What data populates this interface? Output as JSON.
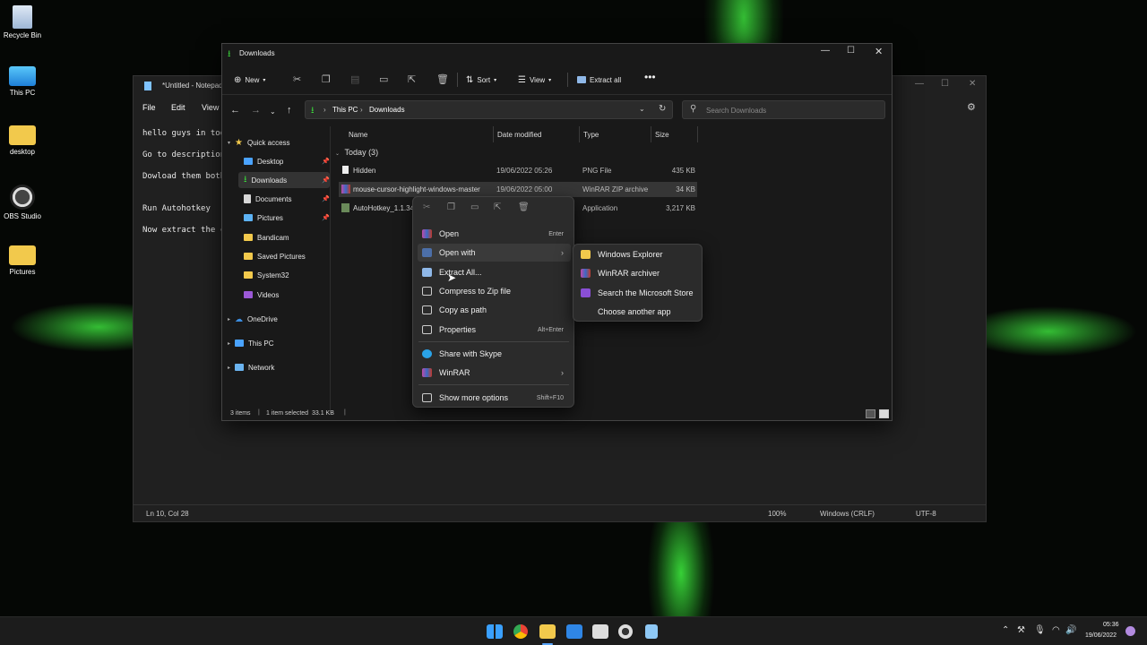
{
  "desktop": {
    "icons": [
      {
        "label": "Recycle Bin",
        "icon": "recycle-bin-icon"
      },
      {
        "label": "This PC",
        "icon": "monitor-icon"
      },
      {
        "label": "desktop",
        "icon": "folder-icon"
      },
      {
        "label": "OBS Studio",
        "icon": "obs-icon"
      },
      {
        "label": "Pictures",
        "icon": "folder-icon"
      }
    ]
  },
  "notepad": {
    "title": "*Untitled - Notepad",
    "menu": [
      "File",
      "Edit",
      "View"
    ],
    "lines": [
      "hello guys in today",
      "Go to description",
      "Dowload them both",
      "Run Autohotkey",
      "Now extract the c"
    ],
    "status": {
      "position": "Ln 10, Col 28",
      "zoom": "100%",
      "line_ending": "Windows (CRLF)",
      "encoding": "UTF-8"
    }
  },
  "explorer": {
    "title": "Downloads",
    "toolbar": {
      "new": "New",
      "sort": "Sort",
      "view": "View",
      "extract_all": "Extract all"
    },
    "breadcrumb": [
      "This PC",
      "Downloads"
    ],
    "search_placeholder": "Search Downloads",
    "nav": {
      "quick_access": "Quick access",
      "items": [
        "Desktop",
        "Downloads",
        "Documents",
        "Pictures",
        "Bandicam",
        "Saved Pictures",
        "System32",
        "Videos"
      ],
      "onedrive": "OneDrive",
      "thispc": "This PC",
      "network": "Network"
    },
    "columns": {
      "name": "Name",
      "date": "Date modified",
      "type": "Type",
      "size": "Size"
    },
    "group": "Today (3)",
    "files": [
      {
        "name": "Hidden",
        "date": "19/06/2022 05:26",
        "type": "PNG File",
        "size": "435 KB"
      },
      {
        "name": "mouse-cursor-highlight-windows-master",
        "date": "19/06/2022 05:00",
        "type": "WinRAR ZIP archive",
        "size": "34 KB"
      },
      {
        "name": "AutoHotkey_1.1.34",
        "date": "",
        "type": "Application",
        "size": "3,217 KB"
      }
    ],
    "status": {
      "items": "3 items",
      "selected": "1 item selected  33.1 KB"
    }
  },
  "context_menu": {
    "open": "Open",
    "open_sc": "Enter",
    "open_with": "Open with",
    "extract": "Extract All...",
    "compress": "Compress to Zip file",
    "copy_path": "Copy as path",
    "properties": "Properties",
    "properties_sc": "Alt+Enter",
    "skype": "Share with Skype",
    "winrar": "WinRAR",
    "more": "Show more options",
    "more_sc": "Shift+F10"
  },
  "open_with_menu": [
    "Windows Explorer",
    "WinRAR archiver",
    "Search the Microsoft Store",
    "Choose another app"
  ],
  "taskbar": {
    "time": "05:36",
    "date": "19/06/2022"
  },
  "colors": {
    "accent": "#1f8fff",
    "folder": "#f2c94c",
    "green": "#3ad43a"
  }
}
